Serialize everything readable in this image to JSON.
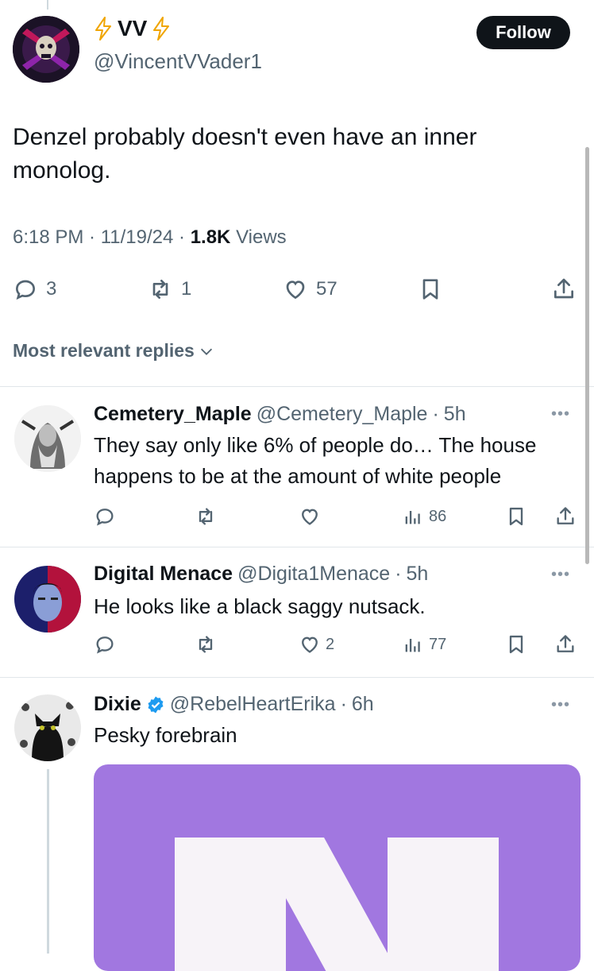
{
  "main_post": {
    "display_name": "VV",
    "handle": "@VincentVVader1",
    "follow_label": "Follow",
    "text": "Denzel probably doesn't even have an inner monolog.",
    "time": "6:18 PM",
    "date": "11/19/24",
    "views_count": "1.8K",
    "views_label": "Views",
    "stats": {
      "replies": "3",
      "reposts": "1",
      "likes": "57"
    }
  },
  "sort": {
    "label": "Most relevant replies"
  },
  "replies": [
    {
      "display_name": "Cemetery_Maple",
      "handle": "@Cemetery_Maple",
      "age": "5h",
      "text": "They say only like 6% of people do… The house happens to be at the amount of white people",
      "likes": "",
      "views": "86"
    },
    {
      "display_name": "Digital Menace",
      "handle": "@Digita1Menace",
      "age": "5h",
      "text": "He looks like a black saggy nutsack.",
      "likes": "2",
      "views": "77"
    },
    {
      "display_name": "Dixie",
      "handle": "@RebelHeartErika",
      "age": "6h",
      "text": "Pesky forebrain",
      "verified": true
    }
  ],
  "icons": [
    "lightning-icon",
    "reply-icon",
    "repost-icon",
    "like-icon",
    "bookmark-icon",
    "share-icon",
    "views-icon",
    "more-icon",
    "verified-badge-icon",
    "chevron-down-icon"
  ],
  "colors": {
    "accent_dark": "#0f1419",
    "muted": "#536471",
    "verified": "#1d9bf0",
    "lightning": "#f0a500",
    "media_bg": "#a177e0"
  }
}
